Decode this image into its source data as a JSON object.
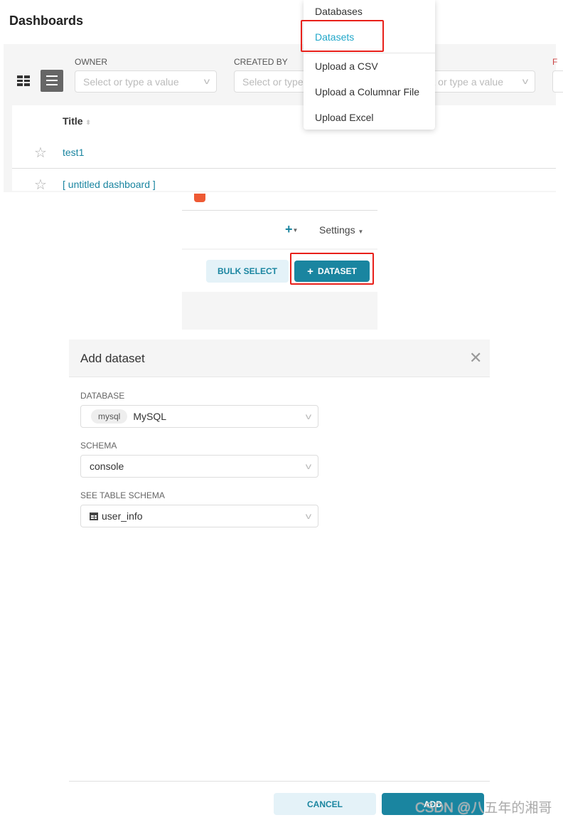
{
  "page": {
    "title": "Dashboards"
  },
  "view_toggle": {
    "grid_icon": "grid-icon",
    "list_icon": "list-icon",
    "active": "list"
  },
  "filters": [
    {
      "label": "OWNER",
      "placeholder": "Select or type a value"
    },
    {
      "label": "CREATED BY",
      "placeholder": "Select or type a value"
    },
    {
      "label": "",
      "placeholder": "Select or type a value"
    },
    {
      "label": "F",
      "placeholder": ""
    }
  ],
  "dropdown_menu": {
    "items": [
      "Databases",
      "Datasets",
      "Upload a CSV",
      "Upload a Columnar File",
      "Upload Excel"
    ],
    "highlighted": "Datasets"
  },
  "table": {
    "header": "Title",
    "rows": [
      {
        "title": "test1"
      },
      {
        "title": "[ untitled dashboard ]"
      }
    ]
  },
  "toolbar": {
    "plus": "+",
    "settings": "Settings",
    "bulk_select": "BULK SELECT",
    "add_dataset": "DATASET"
  },
  "modal": {
    "title": "Add dataset",
    "database_label": "DATABASE",
    "database_tag": "mysql",
    "database_value": "MySQL",
    "schema_label": "SCHEMA",
    "schema_value": "console",
    "table_label": "SEE TABLE SCHEMA",
    "table_value": "user_info",
    "cancel": "CANCEL",
    "add": "ADD"
  },
  "watermark": "CSDN @八五年的湘哥",
  "colors": {
    "accent": "#1a85a0",
    "highlight": "#20a7c9",
    "annotation": "#e8201a",
    "light_button": "#e4f2f8"
  }
}
